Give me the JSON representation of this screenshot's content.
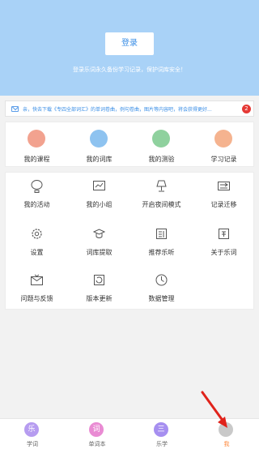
{
  "header": {
    "login_label": "登录",
    "tip": "登录乐词永久备份学习记录，保护词库安全！"
  },
  "notice": {
    "text": "亲，快去下载《专四全部词汇》的单词卷曲，例句卷曲，图片等内容吧，将会获得更好...",
    "badge": "2"
  },
  "main_menu": [
    {
      "label": "我的课程",
      "icon": "course-icon",
      "color": "#f2a28f"
    },
    {
      "label": "我的词库",
      "icon": "wordbank-icon",
      "color": "#8ec3f0"
    },
    {
      "label": "我的测验",
      "icon": "test-icon",
      "color": "#8fd19e"
    },
    {
      "label": "学习记录",
      "icon": "record-icon",
      "color": "#f5b38f"
    }
  ],
  "sub_menu": [
    {
      "label": "我的活动",
      "icon": "balloon-icon"
    },
    {
      "label": "我的小组",
      "icon": "group-icon"
    },
    {
      "label": "开启夜间模式",
      "icon": "lamp-icon"
    },
    {
      "label": "记录迁移",
      "icon": "migrate-icon"
    },
    {
      "label": "设置",
      "icon": "gear-icon"
    },
    {
      "label": "词库提取",
      "icon": "extract-icon"
    },
    {
      "label": "推荐乐听",
      "icon": "listen-icon"
    },
    {
      "label": "关于乐词",
      "icon": "about-icon"
    },
    {
      "label": "问题与反馈",
      "icon": "feedback-icon"
    },
    {
      "label": "版本更新",
      "icon": "update-icon"
    },
    {
      "label": "数据管理",
      "icon": "data-icon"
    }
  ],
  "tabs": [
    {
      "label": "学词",
      "glyph": "乐",
      "color": "#b69cf0"
    },
    {
      "label": "单词本",
      "glyph": "词",
      "color": "#e98bd3"
    },
    {
      "label": "乐学",
      "glyph": "三",
      "color": "#a68ff0"
    },
    {
      "label": "我",
      "glyph": "",
      "color": "#c9c9c9"
    }
  ]
}
